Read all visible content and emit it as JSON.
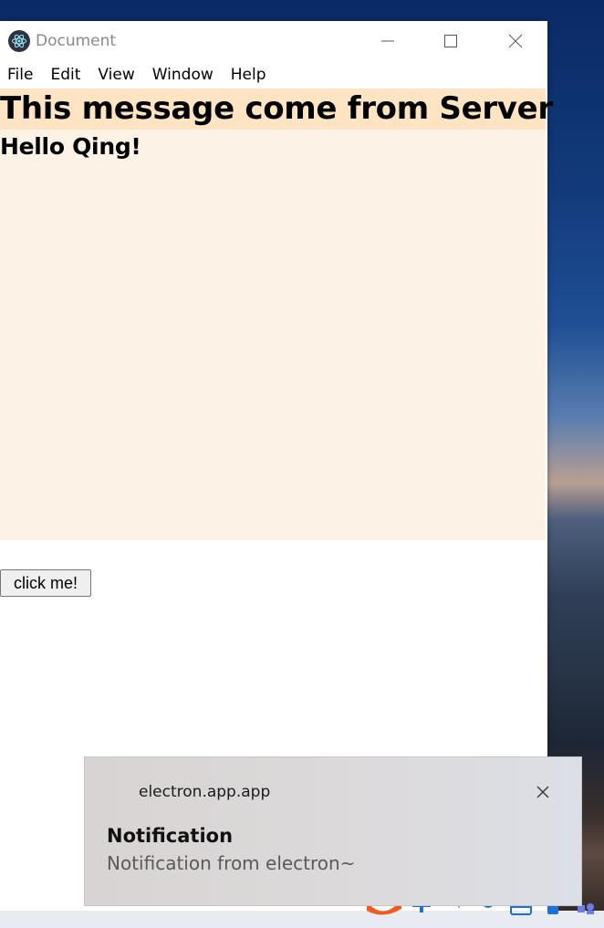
{
  "window": {
    "title": "Document",
    "controls": {
      "minimize": "minimize-icon",
      "maximize": "maximize-icon",
      "close": "close-icon"
    }
  },
  "menu": {
    "items": [
      {
        "label": "File"
      },
      {
        "label": "Edit"
      },
      {
        "label": "View"
      },
      {
        "label": "Window"
      },
      {
        "label": "Help"
      }
    ]
  },
  "content": {
    "headline": "This message come from Server",
    "greeting": "Hello Qing!",
    "button_label": "click me!"
  },
  "notification": {
    "app_name": "electron.app.app",
    "title": "Notification",
    "body": "Notification from electron~"
  },
  "colors": {
    "headline_bg": "#ffe4c4",
    "message_area_bg": "#fcf2e6",
    "toast_bg": "#dcdadc"
  }
}
